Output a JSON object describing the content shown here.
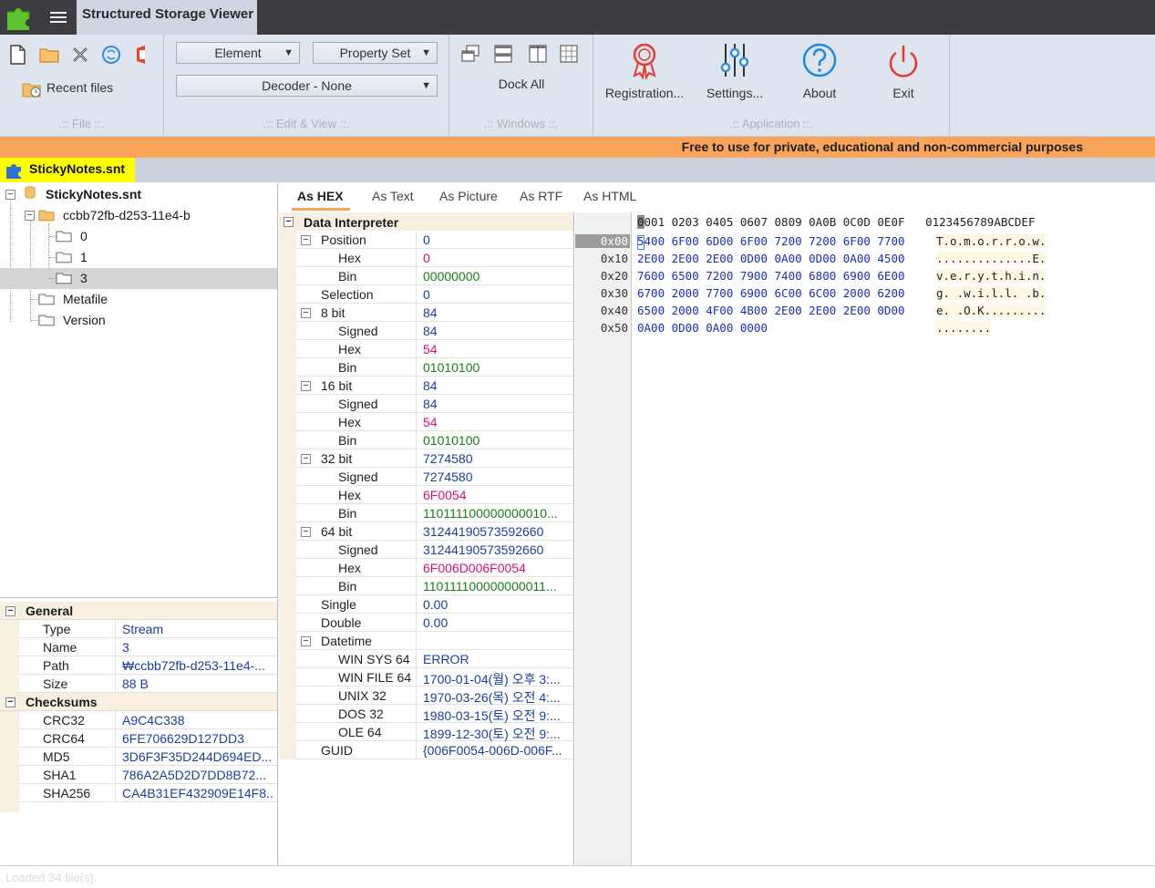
{
  "app": {
    "title": "Structured Storage Viewer",
    "banner": "Free to use for private, educational and non-commercial  purposes",
    "status_text": "Loaded 34 file(s)."
  },
  "ribbon": {
    "file": {
      "caption": ".:: File ::.",
      "recent_label": "Recent files",
      "icons": [
        "new-file-icon",
        "open-folder-icon",
        "close-icon",
        "refresh-icon",
        "office-icon"
      ]
    },
    "edit": {
      "caption": ".:: Edit & View ::.",
      "element_dd": "Element",
      "propset_dd": "Property Set",
      "decoder_dd": "Decoder - None"
    },
    "windows": {
      "caption": ".:: Windows ::.",
      "dock_all": "Dock All"
    },
    "application": {
      "caption": ".:: Application ::.",
      "registration": "Registration...",
      "settings": "Settings...",
      "about": "About",
      "exit": "Exit"
    }
  },
  "doc_tab": "StickyNotes.snt",
  "tree": {
    "root": "StickyNotes.snt",
    "storage": "ccbb72fb-d253-11e4-b",
    "items": [
      "0",
      "1",
      "3",
      "Metafile",
      "Version"
    ]
  },
  "properties": {
    "general_label": "General",
    "general": [
      {
        "k": "Type",
        "v": "Stream"
      },
      {
        "k": "Name",
        "v": "3"
      },
      {
        "k": "Path",
        "v": "₩ccbb72fb-d253-11e4-..."
      },
      {
        "k": "Size",
        "v": "88 B"
      }
    ],
    "checksums_label": "Checksums",
    "checksums": [
      {
        "k": "CRC32",
        "v": "A9C4C338"
      },
      {
        "k": "CRC64",
        "v": "6FE706629D127DD3"
      },
      {
        "k": "MD5",
        "v": "3D6F3F35D244D694ED..."
      },
      {
        "k": "SHA1",
        "v": "786A2A5D2D7DD8B72..."
      },
      {
        "k": "SHA256",
        "v": "CA4B31EF432909E14F8..."
      }
    ]
  },
  "view_tabs": [
    "As HEX",
    "As Text",
    "As Picture",
    "As RTF",
    "As HTML"
  ],
  "interpreter": {
    "title": "Data Interpreter",
    "rows": [
      {
        "k": "Position",
        "v": "0",
        "c": "blue",
        "lvl": 0,
        "exp": true
      },
      {
        "k": "Hex",
        "v": "0",
        "c": "pink",
        "lvl": 1
      },
      {
        "k": "Bin",
        "v": "00000000",
        "c": "green",
        "lvl": 1
      },
      {
        "k": "Selection",
        "v": "0",
        "c": "blue",
        "lvl": 0
      },
      {
        "k": "8 bit",
        "v": "84",
        "c": "blue",
        "lvl": 0,
        "exp": true
      },
      {
        "k": "Signed",
        "v": "84",
        "c": "blue",
        "lvl": 1
      },
      {
        "k": "Hex",
        "v": "54",
        "c": "pink",
        "lvl": 1
      },
      {
        "k": "Bin",
        "v": "01010100",
        "c": "green",
        "lvl": 1
      },
      {
        "k": "16 bit",
        "v": "84",
        "c": "blue",
        "lvl": 0,
        "exp": true
      },
      {
        "k": "Signed",
        "v": "84",
        "c": "blue",
        "lvl": 1
      },
      {
        "k": "Hex",
        "v": "54",
        "c": "pink",
        "lvl": 1
      },
      {
        "k": "Bin",
        "v": "01010100",
        "c": "green",
        "lvl": 1
      },
      {
        "k": "32 bit",
        "v": "7274580",
        "c": "blue",
        "lvl": 0,
        "exp": true
      },
      {
        "k": "Signed",
        "v": "7274580",
        "c": "blue",
        "lvl": 1
      },
      {
        "k": "Hex",
        "v": "6F0054",
        "c": "pink",
        "lvl": 1
      },
      {
        "k": "Bin",
        "v": "110111100000000010...",
        "c": "green",
        "lvl": 1
      },
      {
        "k": "64 bit",
        "v": "31244190573592660",
        "c": "blue",
        "lvl": 0,
        "exp": true
      },
      {
        "k": "Signed",
        "v": "31244190573592660",
        "c": "blue",
        "lvl": 1
      },
      {
        "k": "Hex",
        "v": "6F006D006F0054",
        "c": "pink",
        "lvl": 1
      },
      {
        "k": "Bin",
        "v": "110111100000000011...",
        "c": "green",
        "lvl": 1
      },
      {
        "k": "Single",
        "v": "0.00",
        "c": "blue",
        "lvl": 0
      },
      {
        "k": "Double",
        "v": "0.00",
        "c": "blue",
        "lvl": 0
      },
      {
        "k": "Datetime",
        "v": "",
        "c": "blue",
        "lvl": 0,
        "exp": true
      },
      {
        "k": "WIN SYS 64",
        "v": "ERROR",
        "c": "blue",
        "lvl": 1
      },
      {
        "k": "WIN FILE 64",
        "v": "1700-01-04(월) 오후 3:...",
        "c": "blue",
        "lvl": 1
      },
      {
        "k": "UNIX 32",
        "v": "1970-03-26(목) 오전 4:...",
        "c": "blue",
        "lvl": 1
      },
      {
        "k": "DOS 32",
        "v": "1980-03-15(토) 오전 9:...",
        "c": "blue",
        "lvl": 1
      },
      {
        "k": "OLE 64",
        "v": "1899-12-30(토) 오전 9:...",
        "c": "blue",
        "lvl": 1
      },
      {
        "k": "GUID",
        "v": "{006F0054-006D-006F...",
        "c": "blue",
        "lvl": 0
      }
    ]
  },
  "hex": {
    "header": "0001 0203 0405 0607 0809 0A0B 0C0D 0E0F   0123456789ABCDEF",
    "rows": [
      {
        "off": "0x00",
        "bytes": "5400 6F00 6D00 6F00 7200 7200 6F00 7700",
        "ascii": "T.o.m.o.r.r.o.w."
      },
      {
        "off": "0x10",
        "bytes": "2E00 2E00 2E00 0D00 0A00 0D00 0A00 4500",
        "ascii": "..............E."
      },
      {
        "off": "0x20",
        "bytes": "7600 6500 7200 7900 7400 6800 6900 6E00",
        "ascii": "v.e.r.y.t.h.i.n."
      },
      {
        "off": "0x30",
        "bytes": "6700 2000 7700 6900 6C00 6C00 2000 6200",
        "ascii": "g. .w.i.l.l. .b."
      },
      {
        "off": "0x40",
        "bytes": "6500 2000 4F00 4B00 2E00 2E00 2E00 0D00",
        "ascii": "e. .O.K........."
      },
      {
        "off": "0x50",
        "bytes": "0A00 0D00 0A00 0000",
        "ascii": "........"
      }
    ]
  },
  "colors": {
    "titlebar": "#3c3c41",
    "ribbon": "#dfe5ee",
    "banner": "#f9a45a",
    "doc_tab": "#ffff00",
    "value_blue": "#1b3f9c",
    "value_pink": "#d0127a",
    "value_green": "#148014"
  }
}
